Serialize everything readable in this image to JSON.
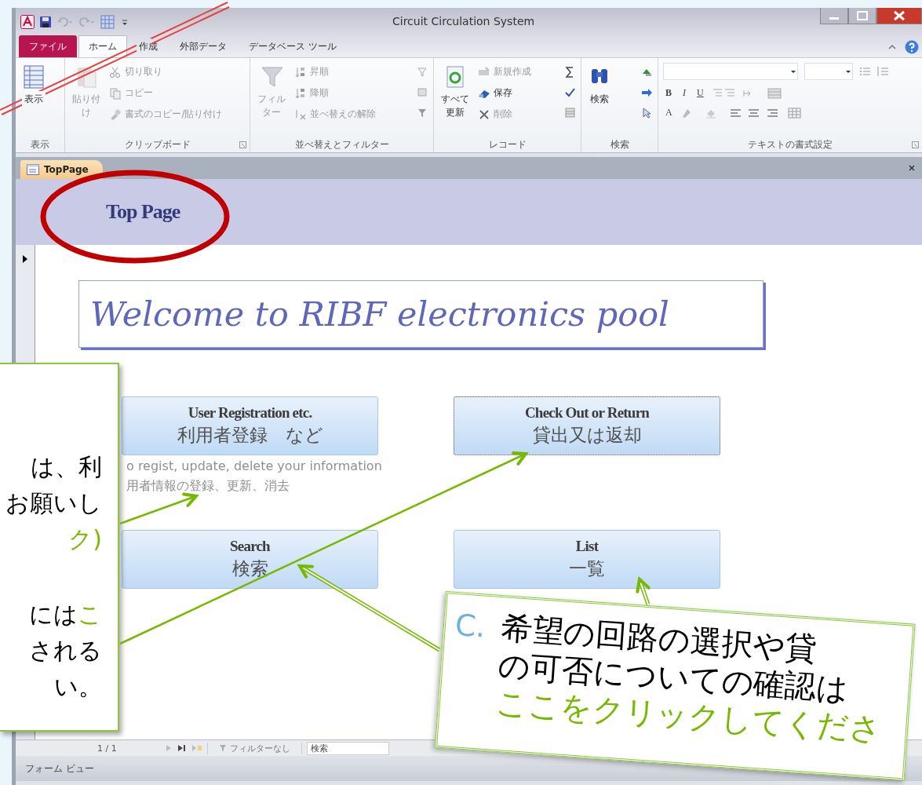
{
  "window": {
    "title": "Circuit Circulation System"
  },
  "ribbon_tabs": [
    {
      "label": "ファイル",
      "kind": "file",
      "selected": false
    },
    {
      "label": "ホーム",
      "kind": "tab",
      "selected": true
    },
    {
      "label": "作成",
      "kind": "tab",
      "selected": false
    },
    {
      "label": "外部データ",
      "kind": "tab",
      "selected": false
    },
    {
      "label": "データベース ツール",
      "kind": "tab",
      "selected": false
    }
  ],
  "ribbon_groups": [
    {
      "label": "表示",
      "kind": "commands",
      "launcher": false,
      "items": [
        {
          "label": "表示",
          "kind": "large",
          "disabled": false
        }
      ]
    },
    {
      "label": "クリップボード",
      "kind": "commands",
      "launcher": true,
      "items": [
        {
          "label": "貼り付け",
          "kind": "large",
          "disabled": true
        },
        {
          "label": "切り取り",
          "kind": "small",
          "disabled": true
        },
        {
          "label": "コピー",
          "kind": "small",
          "disabled": true
        },
        {
          "label": "書式のコピー/貼り付け",
          "kind": "small",
          "disabled": true
        }
      ]
    },
    {
      "label": "並べ替えとフィルター",
      "kind": "commands",
      "launcher": false,
      "items": [
        {
          "label": "フィルター",
          "kind": "large",
          "disabled": true
        },
        {
          "label": "昇順",
          "kind": "small",
          "disabled": true
        },
        {
          "label": "降順",
          "kind": "small",
          "disabled": true
        },
        {
          "label": "並べ替えの解除",
          "kind": "small",
          "disabled": true
        }
      ]
    },
    {
      "label": "レコード",
      "kind": "commands",
      "launcher": false,
      "items": [
        {
          "label": "すべて更新",
          "kind": "large",
          "disabled": false
        },
        {
          "label": "新規作成",
          "kind": "small",
          "disabled": true
        },
        {
          "label": "保存",
          "kind": "small",
          "disabled": false
        },
        {
          "label": "削除",
          "kind": "small",
          "disabled": true
        }
      ]
    },
    {
      "label": "検索",
      "kind": "commands",
      "launcher": false,
      "items": [
        {
          "label": "検索",
          "kind": "large",
          "disabled": false
        }
      ]
    },
    {
      "label": "テキストの書式設定",
      "kind": "formatting",
      "launcher": true,
      "format_buttons": [
        "B",
        "I",
        "U"
      ],
      "color_button": "A"
    }
  ],
  "document_tab": {
    "label": "TopPage"
  },
  "form": {
    "header_title": "Top Page",
    "welcome": "Welcome to RIBF electronics pool",
    "buttons": [
      {
        "title": "User Registration etc.",
        "subtitle": "利用者登録　など",
        "focused": false,
        "notes": [
          "o regist, update, delete your information",
          "用者情報の登録、更新、消去"
        ]
      },
      {
        "title": "Check Out or Return",
        "subtitle": "貸出又は返却",
        "focused": true
      },
      {
        "title": "Search",
        "subtitle": "検索",
        "focused": false
      },
      {
        "title": "List",
        "subtitle": "一覧",
        "focused": false
      }
    ]
  },
  "navigation": {
    "record": "1 / 1",
    "filter": "フィルターなし",
    "search_placeholder": "検索"
  },
  "status_bar": {
    "view": "フォーム ビュー"
  },
  "callout_left": {
    "paragraphs": [
      [
        [
          {
            "text": "は、利",
            "kind": "plain"
          }
        ],
        [
          {
            "text": "お願いし",
            "kind": "plain"
          }
        ],
        [
          {
            "text": "ク)",
            "kind": "emphasis"
          }
        ]
      ],
      [
        [
          {
            "text": "には",
            "kind": "plain"
          },
          {
            "text": "こ",
            "kind": "emphasis"
          }
        ],
        [
          {
            "text": "される",
            "kind": "plain"
          }
        ],
        [
          {
            "text": "い。",
            "kind": "plain"
          }
        ]
      ]
    ]
  },
  "callout_right": {
    "marker": "C.",
    "lines": [
      {
        "text": "希望の回路の選択や貸",
        "kind": "plain"
      },
      {
        "text": "の可否についての確認は",
        "kind": "plain"
      },
      {
        "text": "ここをクリックしてくださ",
        "kind": "emphasis"
      }
    ]
  }
}
